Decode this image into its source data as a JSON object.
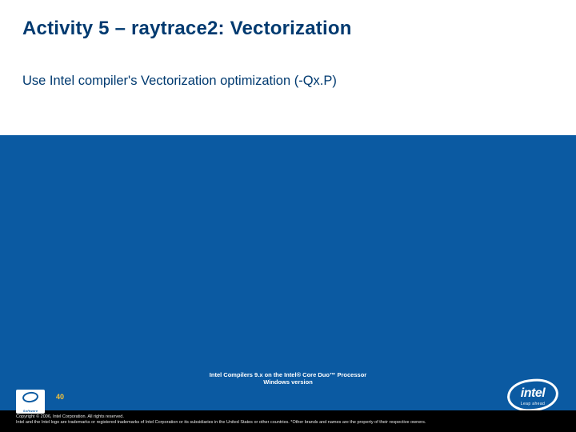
{
  "title": "Activity 5 – raytrace2: Vectorization",
  "body": "Use Intel compiler's Vectorization optimization (-Qx.P)",
  "footer": {
    "product_line1": "Intel Compilers 9.x on the Intel® Core Duo™ Processor",
    "product_line2": "Windows version",
    "page_number": "40",
    "badge_text": "Software",
    "copyright": "Copyright © 2006, Intel Corporation. All rights reserved.",
    "legal": "Intel and the Intel logo are trademarks or registered trademarks of Intel Corporation or its subsidiaries in the United States or other countries. *Other brands and names are the property of their respective owners."
  },
  "logo": {
    "word": "intel",
    "tagline": "Leap ahead"
  }
}
